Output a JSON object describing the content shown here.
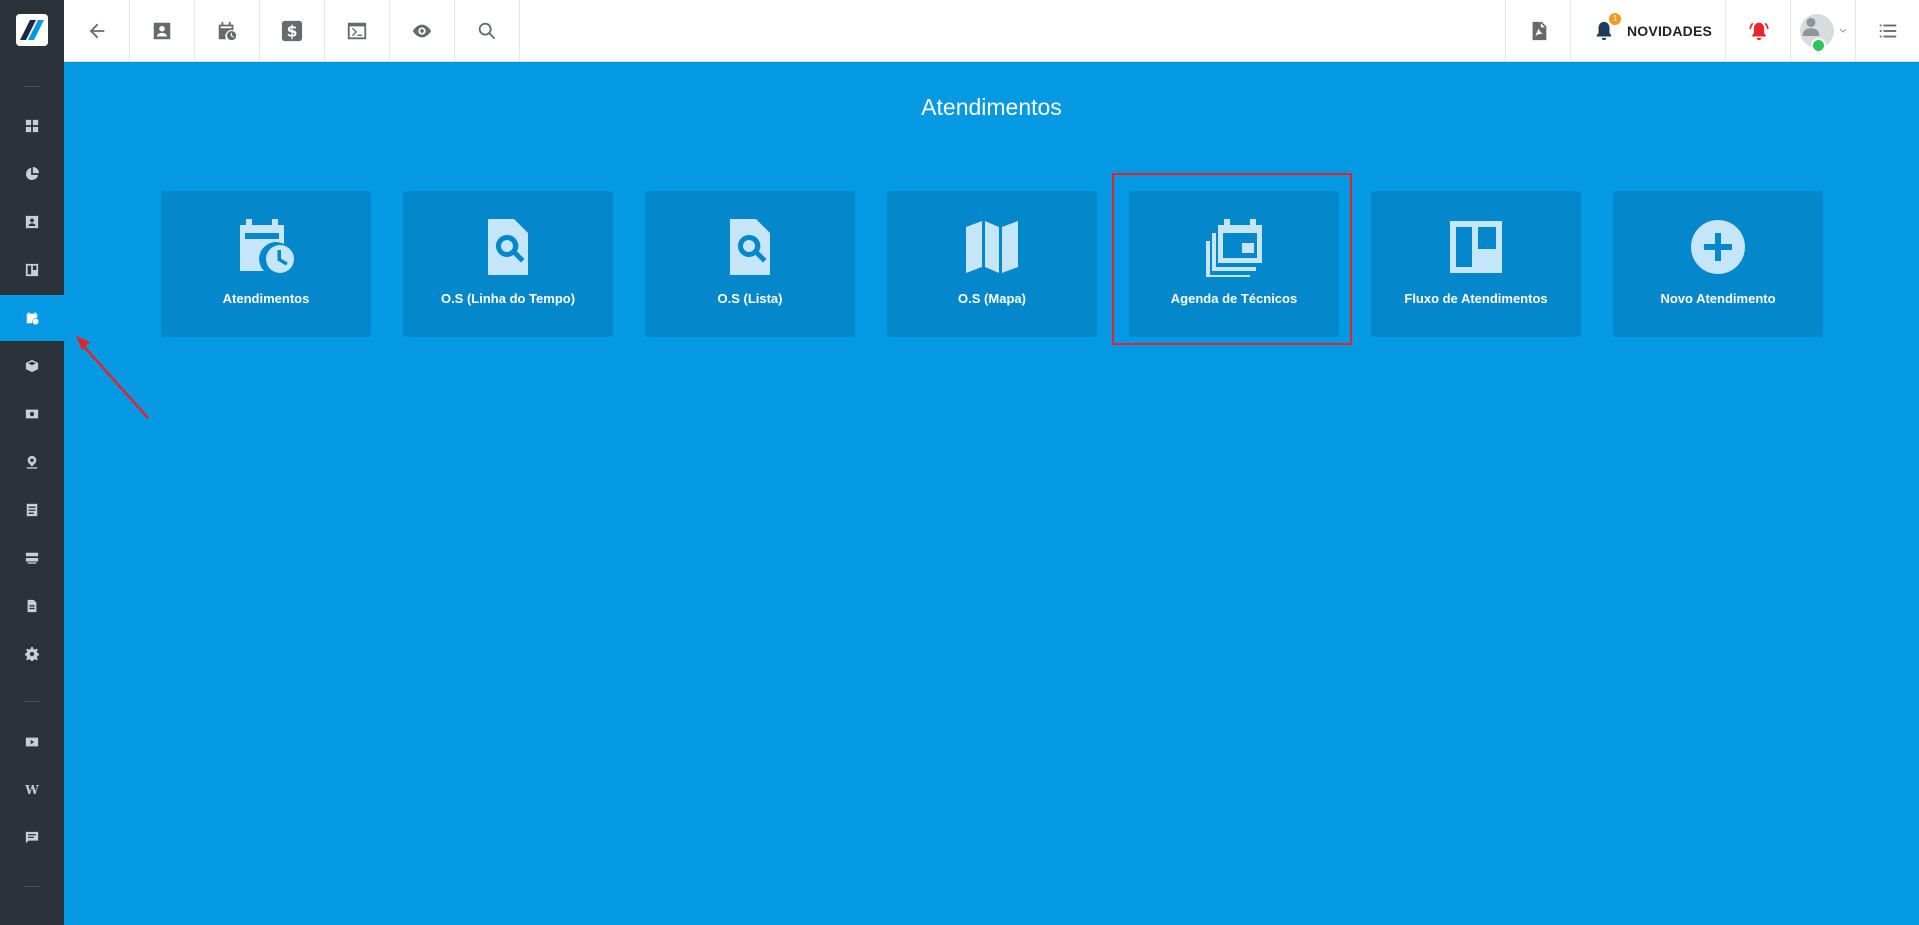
{
  "sidebar": {
    "items": [
      {
        "name": "dashboard",
        "icon": "dashboard-icon"
      },
      {
        "name": "reports",
        "icon": "pie-chart-icon"
      },
      {
        "name": "contacts",
        "icon": "contact-card-icon"
      },
      {
        "name": "board",
        "icon": "board-icon"
      },
      {
        "name": "atendimentos",
        "icon": "calendar-clock-icon",
        "active": true
      },
      {
        "name": "products",
        "icon": "box-icon"
      },
      {
        "name": "finance",
        "icon": "money-icon"
      },
      {
        "name": "location",
        "icon": "map-pin-icon"
      },
      {
        "name": "list",
        "icon": "list-icon"
      },
      {
        "name": "servers",
        "icon": "server-icon"
      },
      {
        "name": "documents",
        "icon": "document-icon"
      },
      {
        "name": "settings",
        "icon": "gear-icon"
      }
    ],
    "bottom_items": [
      {
        "name": "videos",
        "icon": "youtube-icon"
      },
      {
        "name": "wiki",
        "icon": "wiki-icon",
        "glyph": "W"
      },
      {
        "name": "chat",
        "icon": "chat-icon"
      }
    ]
  },
  "topbar": {
    "buttons": [
      "back-arrow-icon",
      "contact-card-icon",
      "calendar-clock-icon",
      "dollar-icon",
      "terminal-icon",
      "eye-icon",
      "search-icon"
    ],
    "novidades_label": "NOVIDADES",
    "notification_count": "1"
  },
  "main": {
    "title": "Atendimentos",
    "tiles": [
      {
        "label": "Atendimentos",
        "icon": "calendar-clock-icon"
      },
      {
        "label": "O.S (Linha do Tempo)",
        "icon": "file-search-icon"
      },
      {
        "label": "O.S (Lista)",
        "icon": "file-search-icon"
      },
      {
        "label": "O.S (Mapa)",
        "icon": "map-icon"
      },
      {
        "label": "Agenda de Técnicos",
        "icon": "calendar-stack-icon",
        "highlighted": true
      },
      {
        "label": "Fluxo de Atendimentos",
        "icon": "kanban-icon"
      },
      {
        "label": "Novo Atendimento",
        "icon": "plus-circle-icon"
      }
    ]
  },
  "colors": {
    "background": "#0599e4",
    "sidebar": "#2c323a",
    "tile": "#0587cc",
    "highlight": "#e4232a",
    "badge": "#f39b1e"
  }
}
